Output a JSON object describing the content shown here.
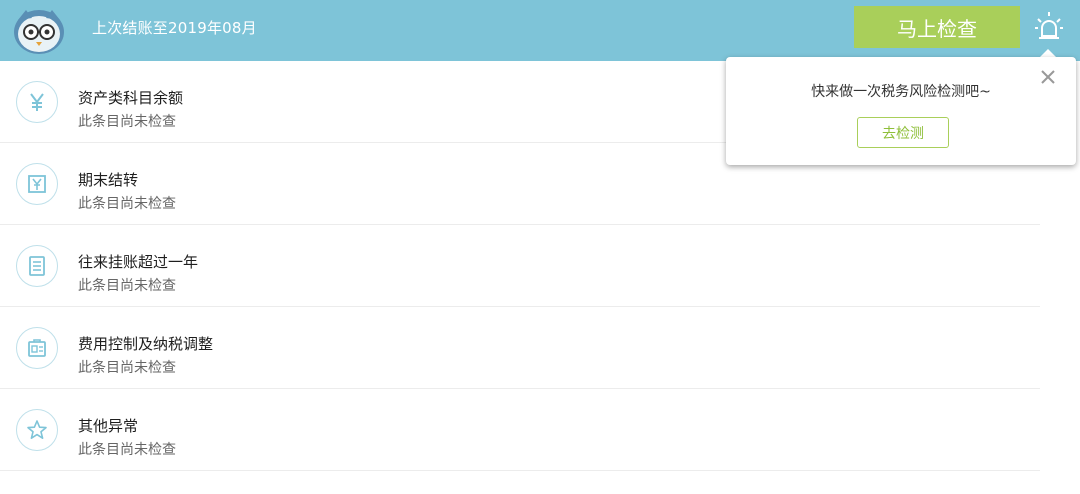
{
  "header": {
    "last_close_text": "上次结账至2019年08月",
    "check_now_label": "马上检查",
    "bg_color": "#7ec4d8",
    "button_color": "#a9cf5a"
  },
  "items": [
    {
      "icon": "yen-icon",
      "title": "资产类科目余额",
      "status": "此条目尚未检查"
    },
    {
      "icon": "ledger-yen-icon",
      "title": "期末结转",
      "status": "此条目尚未检查"
    },
    {
      "icon": "document-list-icon",
      "title": "往来挂账超过一年",
      "status": "此条目尚未检查"
    },
    {
      "icon": "expense-control-icon",
      "title": "费用控制及纳税调整",
      "status": "此条目尚未检查"
    },
    {
      "icon": "star-icon",
      "title": "其他异常",
      "status": "此条目尚未检查"
    }
  ],
  "popup": {
    "message": "快来做一次税务风险检测吧~",
    "go_check_label": "去检测"
  }
}
